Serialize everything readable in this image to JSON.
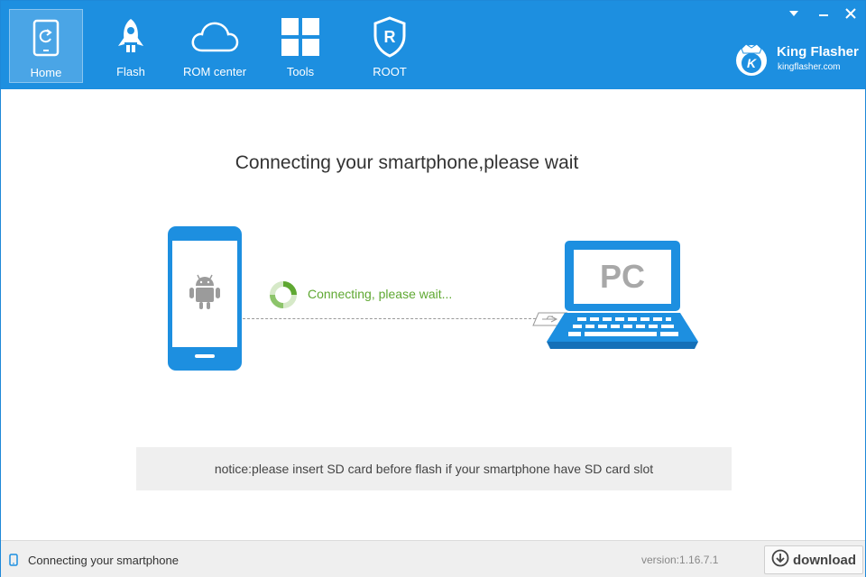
{
  "nav": {
    "items": [
      {
        "label": "Home",
        "icon": "phone-refresh-icon",
        "active": true
      },
      {
        "label": "Flash",
        "icon": "rocket-icon"
      },
      {
        "label": "ROM center",
        "icon": "cloud-icon"
      },
      {
        "label": "Tools",
        "icon": "windows-grid-icon"
      },
      {
        "label": "ROOT",
        "icon": "root-shield-icon"
      }
    ]
  },
  "window_controls": [
    "menu-dropdown-icon",
    "minimize-icon",
    "close-icon"
  ],
  "brand": {
    "name": "King Flasher",
    "site": "kingflasher.com",
    "logo_letter": "K"
  },
  "main": {
    "title": "Connecting your smartphone,please wait",
    "connecting_text": "Connecting, please wait...",
    "pc_label": "PC",
    "notice": "notice:please insert SD card before flash if your smartphone have SD card slot"
  },
  "statusbar": {
    "status_text": "Connecting your smartphone",
    "version": "version:1.16.7.1",
    "download_label": "download"
  },
  "colors": {
    "header": "#1d8fe0",
    "device_blue": "#1d8fe0",
    "connecting_green": "#5fa832"
  }
}
